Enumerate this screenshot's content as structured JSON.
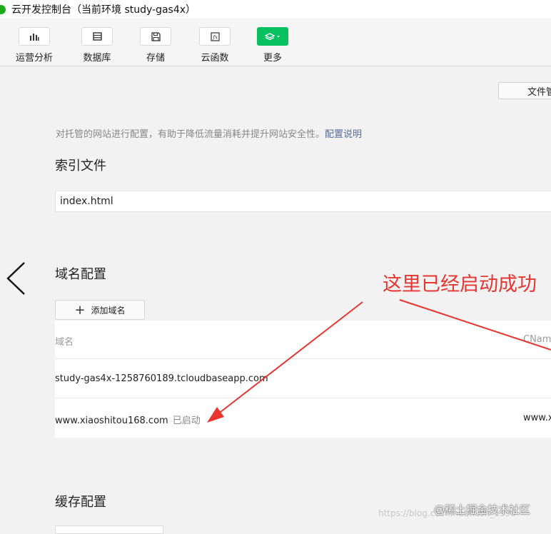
{
  "window": {
    "title": "云开发控制台（当前环境 study-gas4x）"
  },
  "toolbar": {
    "items": [
      {
        "label": "运营分析",
        "icon": "bar-chart-icon"
      },
      {
        "label": "数据库",
        "icon": "database-icon"
      },
      {
        "label": "存储",
        "icon": "save-icon"
      },
      {
        "label": "云函数",
        "icon": "function-icon"
      },
      {
        "label": "更多",
        "icon": "layers-icon"
      }
    ]
  },
  "file_button": {
    "label": "文件管"
  },
  "hosting": {
    "description": "对托管的网站进行配置，有助于降低流量消耗并提升网站安全性。",
    "description_link": "配置说明",
    "index_title": "索引文件",
    "index_value": "index.html",
    "domain_title": "域名配置",
    "add_domain_label": "添加域名",
    "table": {
      "col_domain": "域名",
      "col_cname": "CNam",
      "rows": [
        {
          "domain": "study-gas4x-1258760189.tcloudbaseapp.com",
          "status": "",
          "cname": ""
        },
        {
          "domain": "www.xiaoshitou168.com",
          "status": "已启动",
          "cname": "www.x"
        }
      ]
    },
    "cache_title": "缓存配置"
  },
  "annotation": {
    "text": "这里已经启动成功",
    "color": "#e8352f"
  },
  "watermark": {
    "url": "https://blog.csdn.net/liush_1990",
    "brand": "@稀土掘金技术社区"
  }
}
